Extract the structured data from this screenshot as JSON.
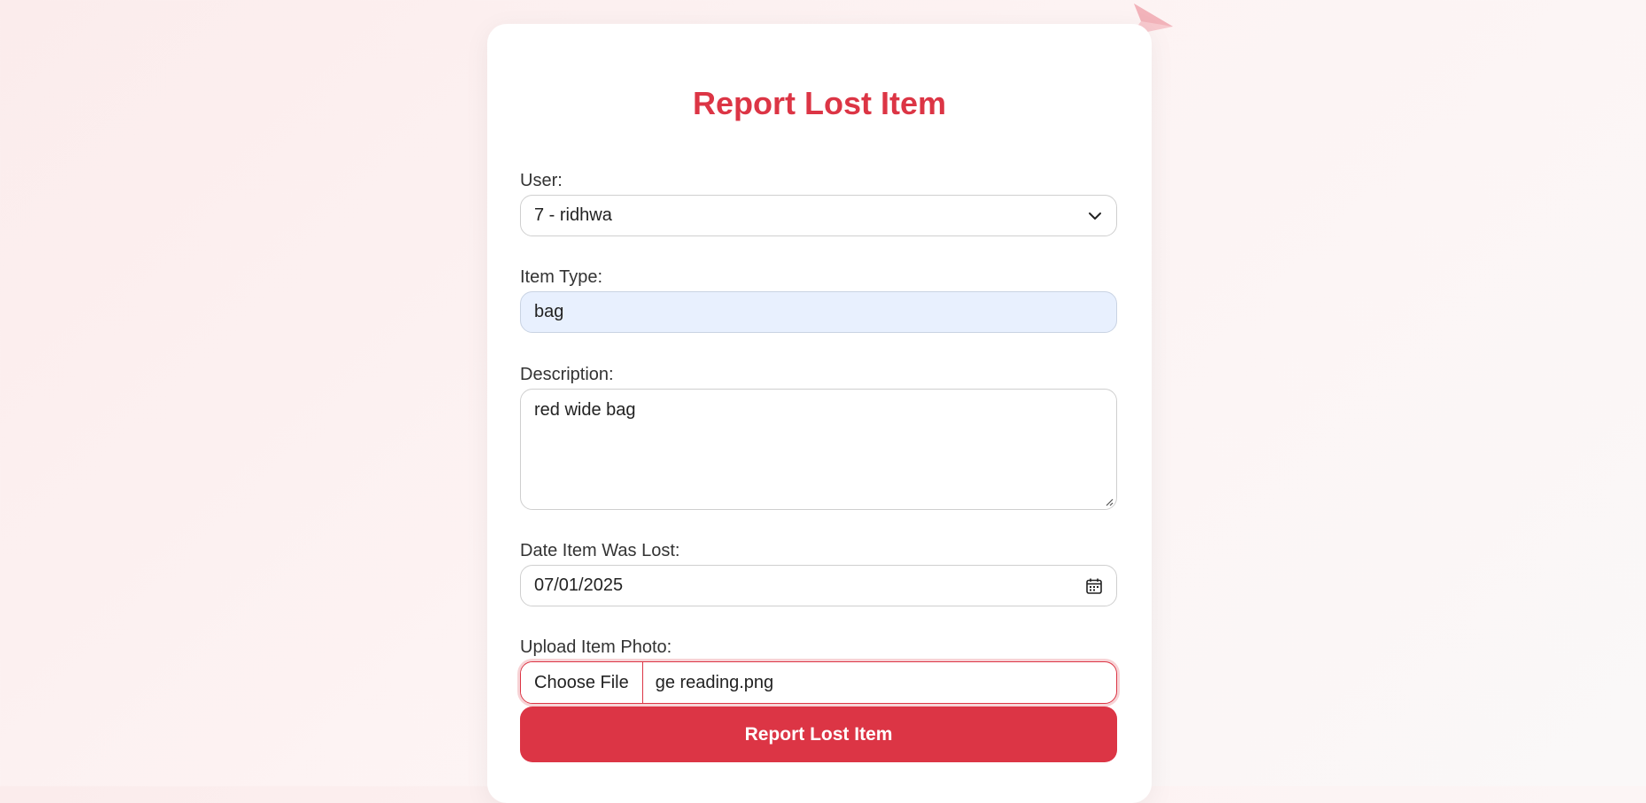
{
  "form": {
    "title": "Report Lost Item",
    "user_label": "User:",
    "user_value": "7 - ridhwa",
    "item_type_label": "Item Type:",
    "item_type_value": "bag",
    "description_label": "Description:",
    "description_value": "red wide bag",
    "date_label": "Date Item Was Lost:",
    "date_value": "07/01/2025",
    "photo_label": "Upload Item Photo:",
    "choose_file_label": "Choose File",
    "file_name": "ge reading.png",
    "submit_label": "Report Lost Item"
  },
  "colors": {
    "accent": "#dc3545",
    "autofill_bg": "#e8f0fe",
    "decoration": "#f0a0a8"
  },
  "icons": {
    "select": "chevron-down-icon",
    "date": "calendar-icon",
    "decorations": [
      "paper-plane-icon",
      "paper-plane-icon"
    ]
  }
}
